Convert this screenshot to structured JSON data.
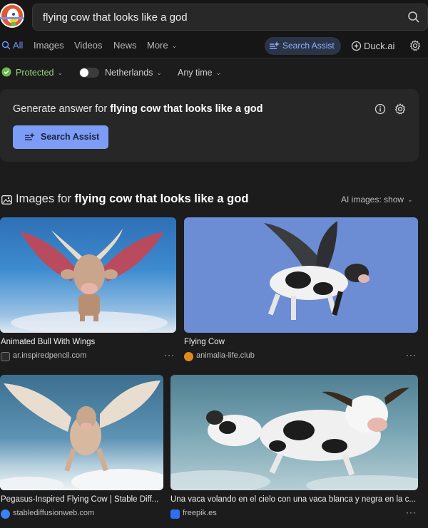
{
  "search": {
    "query": "flying cow that looks like a god"
  },
  "tabs": [
    {
      "label": "All",
      "active": true
    },
    {
      "label": "Images"
    },
    {
      "label": "Videos"
    },
    {
      "label": "News"
    },
    {
      "label": "More"
    }
  ],
  "assist_pill": "Search Assist",
  "duckai": "Duck.ai",
  "filters": {
    "protected": "Protected",
    "region": "Netherlands",
    "time": "Any time"
  },
  "generate": {
    "prefix": "Generate answer for ",
    "query": "flying cow that looks like a god",
    "button": "Search Assist"
  },
  "images_section": {
    "prefix": "Images for ",
    "query": "flying cow that looks like a god",
    "ai_toggle": "AI images: show"
  },
  "results": [
    {
      "caption": "Animated Bull With Wings",
      "source": "ar.inspiredpencil.com"
    },
    {
      "caption": "Flying Cow",
      "source": "animalia-life.club"
    },
    {
      "caption": "Pegasus-Inspired Flying Cow | Stable Diff...",
      "source": "stablediffusionweb.com"
    },
    {
      "caption": "Una vaca volando en el cielo con una vaca blanca y negra en la c...",
      "source": "freepik.es"
    }
  ],
  "colors": {
    "accent": "#7295f6",
    "protected": "#67bd47",
    "duck": "#de5833",
    "button": "#7d9cf5"
  }
}
